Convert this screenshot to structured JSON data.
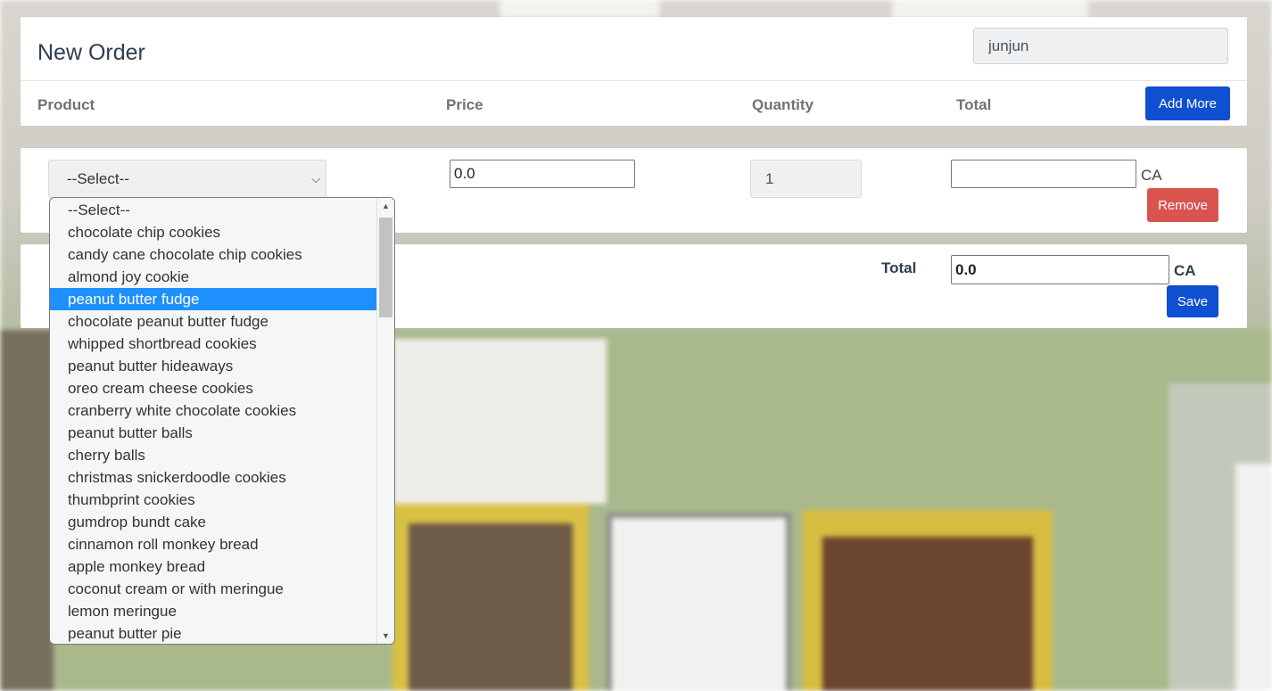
{
  "header": {
    "title": "New Order",
    "user_value": "junjun",
    "columns": [
      "Product",
      "Price",
      "Quantity",
      "Total"
    ],
    "add_more_label": "Add More"
  },
  "row": {
    "select_value": "--Select--",
    "price_value": "0.0",
    "quantity_value": "1",
    "total_value": "",
    "currency": "CA",
    "remove_label": "Remove"
  },
  "summary": {
    "total_label": "Total",
    "total_value": "0.0",
    "currency": "CA",
    "save_label": "Save"
  },
  "dropdown": {
    "selected_index": 4,
    "options": [
      "--Select--",
      "chocolate chip cookies",
      "candy cane chocolate chip cookies",
      "almond joy cookie",
      "peanut butter fudge",
      "chocolate peanut butter fudge",
      "whipped shortbread cookies",
      "peanut butter hideaways",
      "oreo cream cheese cookies",
      "cranberry white chocolate cookies",
      "peanut butter balls",
      "cherry balls",
      "christmas snickerdoodle cookies",
      "thumbprint cookies",
      "gumdrop bundt cake",
      "cinnamon roll monkey bread",
      "apple monkey bread",
      "coconut cream or with meringue",
      "lemon meringue",
      "peanut butter pie"
    ]
  },
  "colors": {
    "primary": "#0f4fd1",
    "danger": "#d9534f",
    "highlight": "#1e90ff"
  }
}
